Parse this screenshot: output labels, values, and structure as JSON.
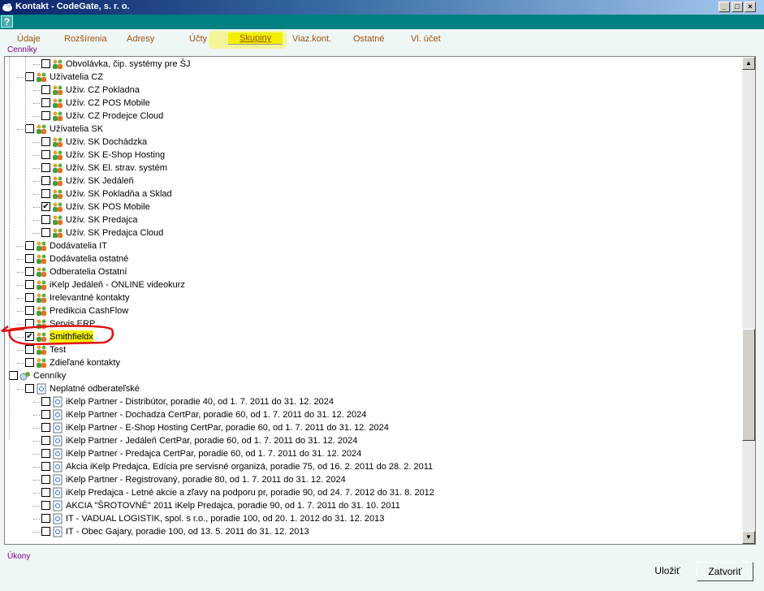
{
  "window": {
    "title": "Kontakt - CodeGate, s. r. o.",
    "buttons": [
      "minimize",
      "maximize",
      "close"
    ]
  },
  "help": {
    "label": "?"
  },
  "tabs": [
    {
      "label": "Údaje"
    },
    {
      "label": "Rozšírenia"
    },
    {
      "label": "Adresy"
    },
    {
      "label": "Účty"
    },
    {
      "label": "Skupiny",
      "active": true
    },
    {
      "label": "Viaz.kont."
    },
    {
      "label": "Ostatné"
    },
    {
      "label": "Vl. účet"
    }
  ],
  "sections": {
    "top": "Cenníky",
    "bottom": "Úkony"
  },
  "tree": [
    {
      "level": 2,
      "checked": false,
      "icon": "group-icon",
      "label": "Obvolávka, čip. systémy pre ŠJ"
    },
    {
      "level": 1,
      "checked": false,
      "icon": "group-icon",
      "label": "Užívatelia CZ"
    },
    {
      "level": 2,
      "checked": false,
      "icon": "group-icon",
      "label": "Užív. CZ Pokladna"
    },
    {
      "level": 2,
      "checked": false,
      "icon": "group-icon",
      "label": "Užív. CZ POS Mobile"
    },
    {
      "level": 2,
      "checked": false,
      "icon": "group-icon",
      "label": "Užív. CZ Prodejce Cloud"
    },
    {
      "level": 1,
      "checked": false,
      "icon": "group-icon",
      "label": "Užívatelia SK"
    },
    {
      "level": 2,
      "checked": false,
      "icon": "group-icon",
      "label": "Užív. SK Dochádzka"
    },
    {
      "level": 2,
      "checked": false,
      "icon": "group-icon",
      "label": "Užív. SK E-Shop Hosting"
    },
    {
      "level": 2,
      "checked": false,
      "icon": "group-icon",
      "label": "Užív. SK El. strav. systém"
    },
    {
      "level": 2,
      "checked": false,
      "icon": "group-icon",
      "label": "Užív. SK Jedáleň"
    },
    {
      "level": 2,
      "checked": false,
      "icon": "group-icon",
      "label": "Užív. SK Pokladňa a Sklad"
    },
    {
      "level": 2,
      "checked": true,
      "icon": "group-icon",
      "label": "Užív. SK POS Mobile"
    },
    {
      "level": 2,
      "checked": false,
      "icon": "group-icon",
      "label": "Užív. SK Predajca"
    },
    {
      "level": 2,
      "checked": false,
      "icon": "group-icon",
      "label": "Užív. SK Predajca Cloud"
    },
    {
      "level": 1,
      "checked": false,
      "icon": "group-icon",
      "label": "Dodávatelia IT"
    },
    {
      "level": 1,
      "checked": false,
      "icon": "group-icon",
      "label": "Dodávatelia ostatné"
    },
    {
      "level": 1,
      "checked": false,
      "icon": "group-icon",
      "label": "Odberatelia Ostatní"
    },
    {
      "level": 1,
      "checked": false,
      "icon": "group-icon",
      "label": "iKelp Jedáleň - ONLINE videokurz"
    },
    {
      "level": 1,
      "checked": false,
      "icon": "group-icon",
      "label": "Irelevantné kontakty"
    },
    {
      "level": 1,
      "checked": false,
      "icon": "group-icon",
      "label": "Predikcia CashFlow"
    },
    {
      "level": 1,
      "checked": false,
      "icon": "group-icon",
      "label": "Servis ERP"
    },
    {
      "level": 1,
      "checked": true,
      "icon": "group-icon",
      "label": "Smithfieldx"
    },
    {
      "level": 1,
      "checked": false,
      "icon": "group-icon",
      "label": "Test"
    },
    {
      "level": 1,
      "checked": false,
      "icon": "group-icon",
      "label": "Zdieľané kontakty"
    },
    {
      "level": 0,
      "checked": false,
      "icon": "pricelist-root-icon",
      "label": "Cenníky"
    },
    {
      "level": 1,
      "checked": false,
      "icon": "document-icon",
      "label": "Neplatné odberateľské"
    },
    {
      "level": 2,
      "checked": false,
      "icon": "document-icon",
      "label": "iKelp Partner - Distribútor, poradie 40, od 1. 7. 2011 do 31. 12. 2024"
    },
    {
      "level": 2,
      "checked": false,
      "icon": "document-icon",
      "label": "iKelp Partner - Dochadza CertPar, poradie 60, od 1. 7. 2011 do 31. 12. 2024"
    },
    {
      "level": 2,
      "checked": false,
      "icon": "document-icon",
      "label": "iKelp Partner - E-Shop Hosting CertPar, poradie 60, od 1. 7. 2011 do 31. 12. 2024"
    },
    {
      "level": 2,
      "checked": false,
      "icon": "document-icon",
      "label": "iKelp Partner - Jedáleň CertPar, poradie 60, od 1. 7. 2011 do 31. 12. 2024"
    },
    {
      "level": 2,
      "checked": false,
      "icon": "document-icon",
      "label": "iKelp Partner - Predajca CertPar, poradie 60, od 1. 7. 2011 do 31. 12. 2024"
    },
    {
      "level": 2,
      "checked": false,
      "icon": "document-icon",
      "label": "Akcia iKelp Predajca, Edícia pre servisné organizá, poradie 75, od 16. 2. 2011 do 28. 2. 2011"
    },
    {
      "level": 2,
      "checked": false,
      "icon": "document-icon",
      "label": "iKelp Partner - Registrovaný, poradie 80, od 1. 7. 2011 do 31. 12. 2024"
    },
    {
      "level": 2,
      "checked": false,
      "icon": "document-icon",
      "label": "iKelp Predajca - Letné akcie a zľavy na podporu pr, poradie 90, od 24. 7. 2012 do 31. 8. 2012"
    },
    {
      "level": 2,
      "checked": false,
      "icon": "document-icon",
      "label": "AKCIA \"ŠROTOVNÉ\" 2011 iKelp Predajca, poradie 90, od 1. 7. 2011 do 31. 10. 2011"
    },
    {
      "level": 2,
      "checked": false,
      "icon": "document-icon",
      "label": "IT - VADUAL LOGISTIK, spol. s r.o., poradie 100, od 20. 1. 2012 do 31. 12. 2013"
    },
    {
      "level": 2,
      "checked": false,
      "icon": "document-icon",
      "label": "IT - Obec Gajary, poradie 100, od 13. 5. 2011 do 31. 12. 2013"
    }
  ],
  "footer": {
    "save_label": "Uložiť",
    "close_label": "Zatvoriť"
  },
  "colors": {
    "tab_text": "#a0520a",
    "section_label": "#800080",
    "active_tab_bg": "#f0f000",
    "annotation": "#e01010"
  }
}
